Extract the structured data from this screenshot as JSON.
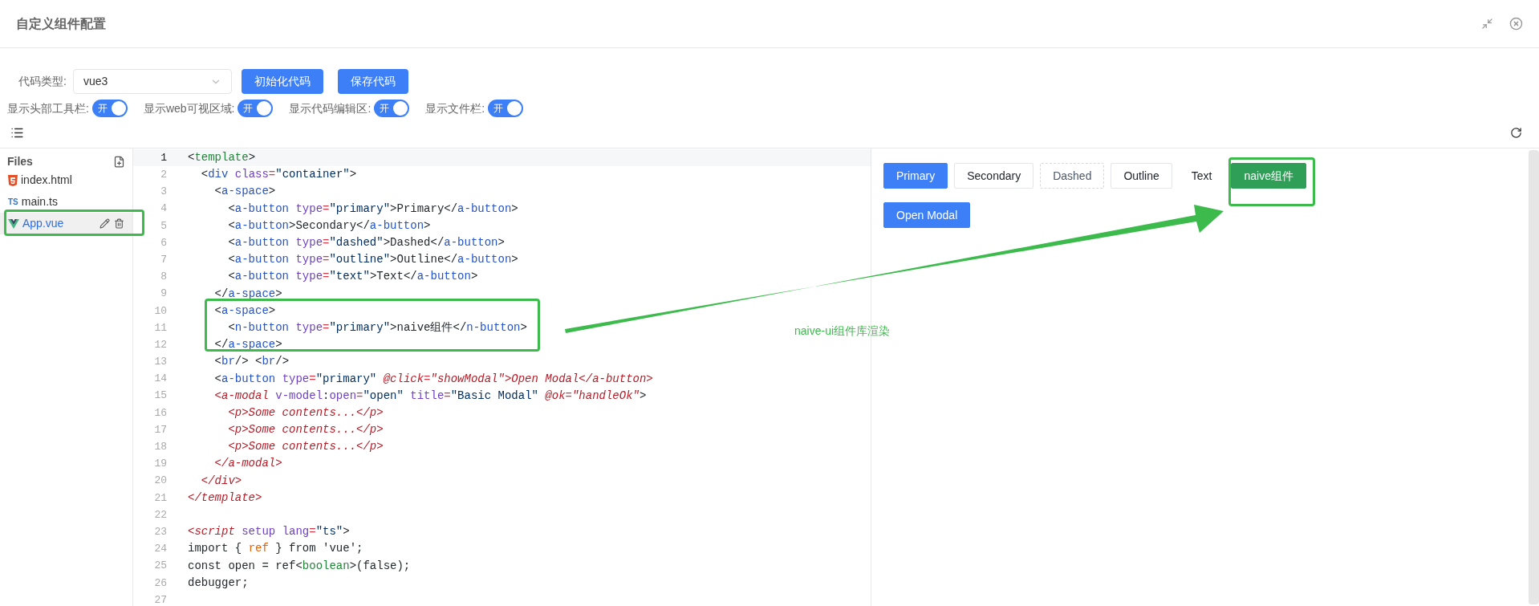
{
  "window": {
    "title": "自定义组件配置"
  },
  "toolbar": {
    "code_type": {
      "label": "代码类型:",
      "value": "vue3"
    },
    "buttons": [
      "初始化代码",
      "保存代码"
    ],
    "toggles": [
      {
        "label": "显示头部工具栏:",
        "on": true,
        "text": "开"
      },
      {
        "label": "显示web可视区域:",
        "on": true,
        "text": "开"
      },
      {
        "label": "显示代码编辑区:",
        "on": true,
        "text": "开"
      },
      {
        "label": "显示文件栏:",
        "on": true,
        "text": "开"
      }
    ]
  },
  "files": {
    "title": "Files",
    "items": [
      {
        "name": "index.html",
        "kind": "html",
        "selected": false
      },
      {
        "name": "main.ts",
        "kind": "ts",
        "badge": "TS",
        "selected": false
      },
      {
        "name": "App.vue",
        "kind": "vue",
        "selected": true
      }
    ]
  },
  "editor": {
    "lines": [
      {
        "number": "1",
        "selected": true,
        "tokens": [
          {
            "kind": "p",
            "text": "<"
          },
          {
            "kind": "tagg",
            "text": "template"
          },
          {
            "kind": "p",
            "text": ">"
          }
        ]
      },
      {
        "number": "2",
        "selected": false,
        "tokens": [
          {
            "kind": "p",
            "text": "  <"
          },
          {
            "kind": "tag",
            "text": "div"
          },
          {
            "kind": "attr",
            "text": " class"
          },
          {
            "kind": "eq",
            "text": "="
          },
          {
            "kind": "str",
            "text": "\"container\""
          },
          {
            "kind": "p",
            "text": ">"
          }
        ]
      },
      {
        "number": "3",
        "selected": false,
        "tokens": [
          {
            "kind": "p",
            "text": "    <"
          },
          {
            "kind": "tag",
            "text": "a-space"
          },
          {
            "kind": "p",
            "text": ">"
          }
        ]
      },
      {
        "number": "4",
        "selected": false,
        "tokens": [
          {
            "kind": "p",
            "text": "      <"
          },
          {
            "kind": "tag",
            "text": "a-button"
          },
          {
            "kind": "attr",
            "text": " type"
          },
          {
            "kind": "eq",
            "text": "="
          },
          {
            "kind": "str",
            "text": "\"primary\""
          },
          {
            "kind": "p",
            "text": ">Primary</"
          },
          {
            "kind": "tag",
            "text": "a-button"
          },
          {
            "kind": "p",
            "text": ">"
          }
        ]
      },
      {
        "number": "5",
        "selected": false,
        "tokens": [
          {
            "kind": "p",
            "text": "      <"
          },
          {
            "kind": "tag",
            "text": "a-button"
          },
          {
            "kind": "p",
            "text": ">Secondary</"
          },
          {
            "kind": "tag",
            "text": "a-button"
          },
          {
            "kind": "p",
            "text": ">"
          }
        ]
      },
      {
        "number": "6",
        "selected": false,
        "tokens": [
          {
            "kind": "p",
            "text": "      <"
          },
          {
            "kind": "tag",
            "text": "a-button"
          },
          {
            "kind": "attr",
            "text": " type"
          },
          {
            "kind": "eq",
            "text": "="
          },
          {
            "kind": "str",
            "text": "\"dashed\""
          },
          {
            "kind": "p",
            "text": ">Dashed</"
          },
          {
            "kind": "tag",
            "text": "a-button"
          },
          {
            "kind": "p",
            "text": ">"
          }
        ]
      },
      {
        "number": "7",
        "selected": false,
        "tokens": [
          {
            "kind": "p",
            "text": "      <"
          },
          {
            "kind": "tag",
            "text": "a-button"
          },
          {
            "kind": "attr",
            "text": " type"
          },
          {
            "kind": "eq",
            "text": "="
          },
          {
            "kind": "str",
            "text": "\"outline\""
          },
          {
            "kind": "p",
            "text": ">Outline</"
          },
          {
            "kind": "tag",
            "text": "a-button"
          },
          {
            "kind": "p",
            "text": ">"
          }
        ]
      },
      {
        "number": "8",
        "selected": false,
        "tokens": [
          {
            "kind": "p",
            "text": "      <"
          },
          {
            "kind": "tag",
            "text": "a-button"
          },
          {
            "kind": "attr",
            "text": " type"
          },
          {
            "kind": "eq",
            "text": "="
          },
          {
            "kind": "str",
            "text": "\"text\""
          },
          {
            "kind": "p",
            "text": ">Text</"
          },
          {
            "kind": "tag",
            "text": "a-button"
          },
          {
            "kind": "p",
            "text": ">"
          }
        ]
      },
      {
        "number": "9",
        "selected": false,
        "tokens": [
          {
            "kind": "p",
            "text": "    </"
          },
          {
            "kind": "tag",
            "text": "a-space"
          },
          {
            "kind": "p",
            "text": ">"
          }
        ]
      },
      {
        "number": "10",
        "selected": false,
        "tokens": [
          {
            "kind": "p",
            "text": "    <"
          },
          {
            "kind": "tag",
            "text": "a-space"
          },
          {
            "kind": "p",
            "text": ">"
          }
        ]
      },
      {
        "number": "11",
        "selected": false,
        "tokens": [
          {
            "kind": "p",
            "text": "      <"
          },
          {
            "kind": "tag",
            "text": "n-button"
          },
          {
            "kind": "attr",
            "text": " type"
          },
          {
            "kind": "eq",
            "text": "="
          },
          {
            "kind": "str",
            "text": "\"primary\""
          },
          {
            "kind": "p",
            "text": ">naive组件</"
          },
          {
            "kind": "tag",
            "text": "n-button"
          },
          {
            "kind": "p",
            "text": ">"
          }
        ]
      },
      {
        "number": "12",
        "selected": false,
        "tokens": [
          {
            "kind": "p",
            "text": "    </"
          },
          {
            "kind": "tag",
            "text": "a-space"
          },
          {
            "kind": "p",
            "text": ">"
          }
        ]
      },
      {
        "number": "13",
        "selected": false,
        "tokens": [
          {
            "kind": "p",
            "text": "    <"
          },
          {
            "kind": "tag",
            "text": "br"
          },
          {
            "kind": "p",
            "text": "/> <"
          },
          {
            "kind": "tag",
            "text": "br"
          },
          {
            "kind": "p",
            "text": "/>"
          }
        ]
      },
      {
        "number": "14",
        "selected": false,
        "tokens": [
          {
            "kind": "p",
            "text": "    <"
          },
          {
            "kind": "tag",
            "text": "a-button"
          },
          {
            "kind": "attr",
            "text": " type"
          },
          {
            "kind": "eq",
            "text": "="
          },
          {
            "kind": "str",
            "text": "\"primary\""
          },
          {
            "kind": "err",
            "text": " @click"
          },
          {
            "kind": "eq",
            "text": "="
          },
          {
            "kind": "err",
            "text": "\"showModal\">Open Modal</a-button>"
          }
        ]
      },
      {
        "number": "15",
        "selected": false,
        "tokens": [
          {
            "kind": "err",
            "text": "    <a-modal"
          },
          {
            "kind": "attr",
            "text": " v-model"
          },
          {
            "kind": "p",
            "text": ":"
          },
          {
            "kind": "attr",
            "text": "open"
          },
          {
            "kind": "eq",
            "text": "="
          },
          {
            "kind": "str",
            "text": "\"open\""
          },
          {
            "kind": "attr",
            "text": " title"
          },
          {
            "kind": "eq",
            "text": "="
          },
          {
            "kind": "str",
            "text": "\"Basic Modal\""
          },
          {
            "kind": "err",
            "text": " @ok"
          },
          {
            "kind": "eq",
            "text": "="
          },
          {
            "kind": "err",
            "text": "\"handleOk\""
          },
          {
            "kind": "p",
            "text": ">"
          }
        ]
      },
      {
        "number": "16",
        "selected": false,
        "tokens": [
          {
            "kind": "err",
            "text": "      <p>Some contents...</p>"
          }
        ]
      },
      {
        "number": "17",
        "selected": false,
        "tokens": [
          {
            "kind": "err",
            "text": "      <p>Some contents...</p>"
          }
        ]
      },
      {
        "number": "18",
        "selected": false,
        "tokens": [
          {
            "kind": "err",
            "text": "      <p>Some contents...</p>"
          }
        ]
      },
      {
        "number": "19",
        "selected": false,
        "tokens": [
          {
            "kind": "err",
            "text": "    </a-modal>"
          }
        ]
      },
      {
        "number": "20",
        "selected": false,
        "tokens": [
          {
            "kind": "err",
            "text": "  </div>"
          }
        ]
      },
      {
        "number": "21",
        "selected": false,
        "tokens": [
          {
            "kind": "err",
            "text": "</template>"
          }
        ]
      },
      {
        "number": "22",
        "selected": false
      },
      {
        "number": "23",
        "selected": false,
        "tokens": [
          {
            "kind": "err",
            "text": "<script"
          },
          {
            "kind": "attr",
            "text": " setup"
          },
          {
            "kind": "attr",
            "text": " lang"
          },
          {
            "kind": "eq",
            "text": "="
          },
          {
            "kind": "str",
            "text": "\"ts\""
          },
          {
            "kind": "p",
            "text": ">"
          }
        ]
      },
      {
        "number": "24",
        "selected": false,
        "tokens": [
          {
            "kind": "p",
            "text": "import { "
          },
          {
            "kind": "kw",
            "text": "ref"
          },
          {
            "kind": "p",
            "text": " } from 'vue';"
          }
        ]
      },
      {
        "number": "25",
        "selected": false,
        "tokens": [
          {
            "kind": "p",
            "text": "const open = ref<"
          },
          {
            "kind": "tagg",
            "text": "boolean"
          },
          {
            "kind": "p",
            "text": ">(false);"
          }
        ]
      },
      {
        "number": "26",
        "selected": false,
        "tokens": [
          {
            "kind": "p",
            "text": "debugger;"
          }
        ]
      },
      {
        "number": "27",
        "selected": false
      }
    ]
  },
  "preview": {
    "rows": [
      [
        {
          "label": "Primary",
          "kind": "primary"
        },
        {
          "label": "Secondary",
          "kind": "secondary"
        },
        {
          "label": "Dashed",
          "kind": "dashed"
        },
        {
          "label": "Outline",
          "kind": "outline"
        },
        {
          "label": "Text",
          "kind": "text"
        },
        {
          "label": "naive组件",
          "kind": "naive"
        }
      ],
      [
        {
          "label": "Open Modal",
          "kind": "primary"
        }
      ]
    ]
  },
  "annotation": {
    "text": "naive-ui组件库渲染"
  }
}
